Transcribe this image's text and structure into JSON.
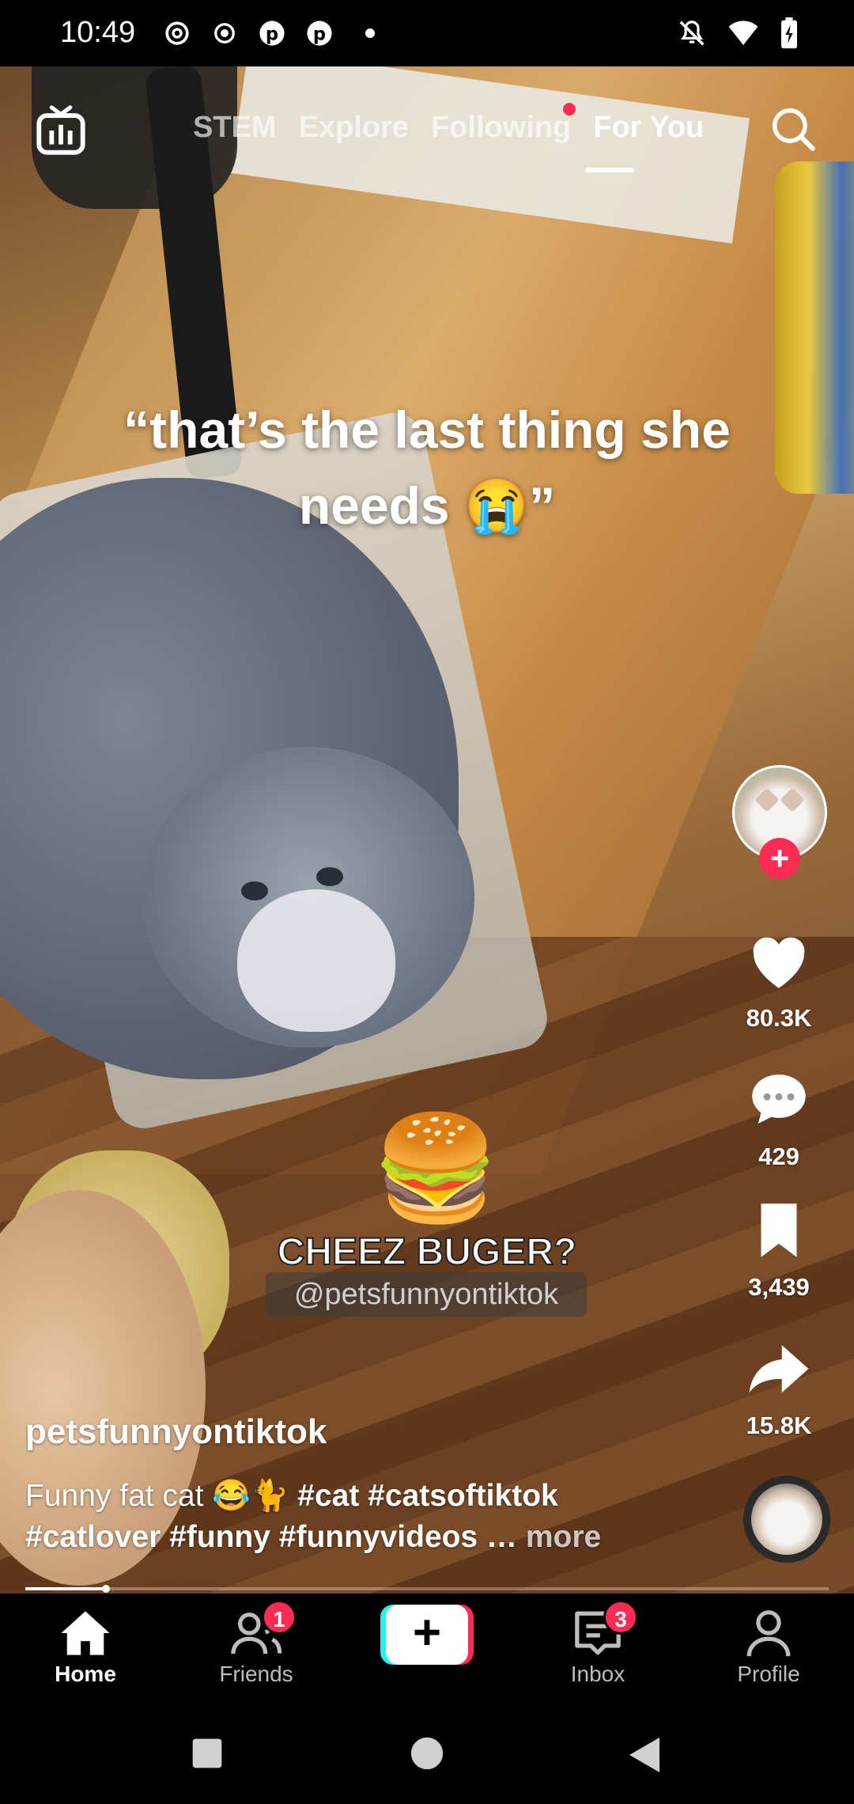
{
  "status_bar": {
    "time": "10:49"
  },
  "top_nav": {
    "tabs": [
      {
        "label": "STEM"
      },
      {
        "label": "Explore"
      },
      {
        "label": "Following"
      },
      {
        "label": "For You"
      }
    ],
    "active_tab": "For You"
  },
  "video": {
    "caption": "“that’s the last thing she needs 😭”",
    "sticker_emoji": "🍔",
    "sticker_text": "CHEEZ BUGER?",
    "watermark": "@petsfunnyontiktok"
  },
  "rail": {
    "likes": "80.3K",
    "comments": "429",
    "saves": "3,439",
    "shares": "15.8K"
  },
  "post": {
    "username": "petsfunnyontiktok",
    "description_prefix": "Funny fat cat 😂🐈 ",
    "description_tags_line1": "#cat #catsoftiktok",
    "description_tags_line2": "#catlover #funny #funnyvideos …",
    "more_label": "more",
    "progress": 0.1
  },
  "bottom_nav": {
    "items": [
      {
        "label": "Home"
      },
      {
        "label": "Friends",
        "badge": "1"
      },
      {
        "label": "Inbox",
        "badge": "3"
      },
      {
        "label": "Profile"
      }
    ],
    "create_symbol": "+"
  },
  "colors": {
    "accent": "#fe2c55",
    "cyan": "#25f4ee"
  }
}
